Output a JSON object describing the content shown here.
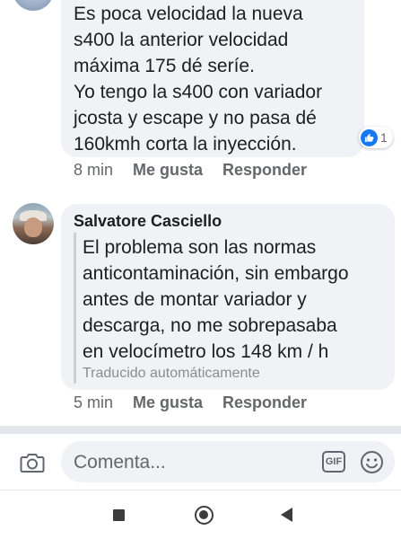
{
  "comment1": {
    "text": "Es poca velocidad la nueva\ns400 la anterior velocidad\nmáxima 175 dé seríe.\nYo tengo la s400 con variador\njcosta y escape y no pasa dé\n160kmh corta la inyección.",
    "reaction_count": "1",
    "time": "8 min",
    "like_label": "Me gusta",
    "reply_label": "Responder"
  },
  "comment2": {
    "author": "Salvatore Casciello",
    "text": "El problema son las normas\nanticontaminación, sin embargo\nantes de montar variador y\ndescarga, no me sobrepasaba\nen velocímetro los 148 km / h",
    "translated_label": "Traducido automáticamente",
    "time": "5 min",
    "like_label": "Me gusta",
    "reply_label": "Responder"
  },
  "composer": {
    "placeholder": "Comenta...",
    "gif_label": "GIF"
  },
  "icons": {
    "camera": "camera-icon",
    "emoji": "emoji-icon",
    "like": "like-thumb-icon",
    "nav_recents": "square-icon",
    "nav_home": "home-circle-icon",
    "nav_back": "back-triangle-icon"
  },
  "colors": {
    "bubble": "#f0f2f5",
    "like_blue": "#1877f2",
    "meta_text": "#65676b",
    "divider": "#e4e6eb"
  }
}
